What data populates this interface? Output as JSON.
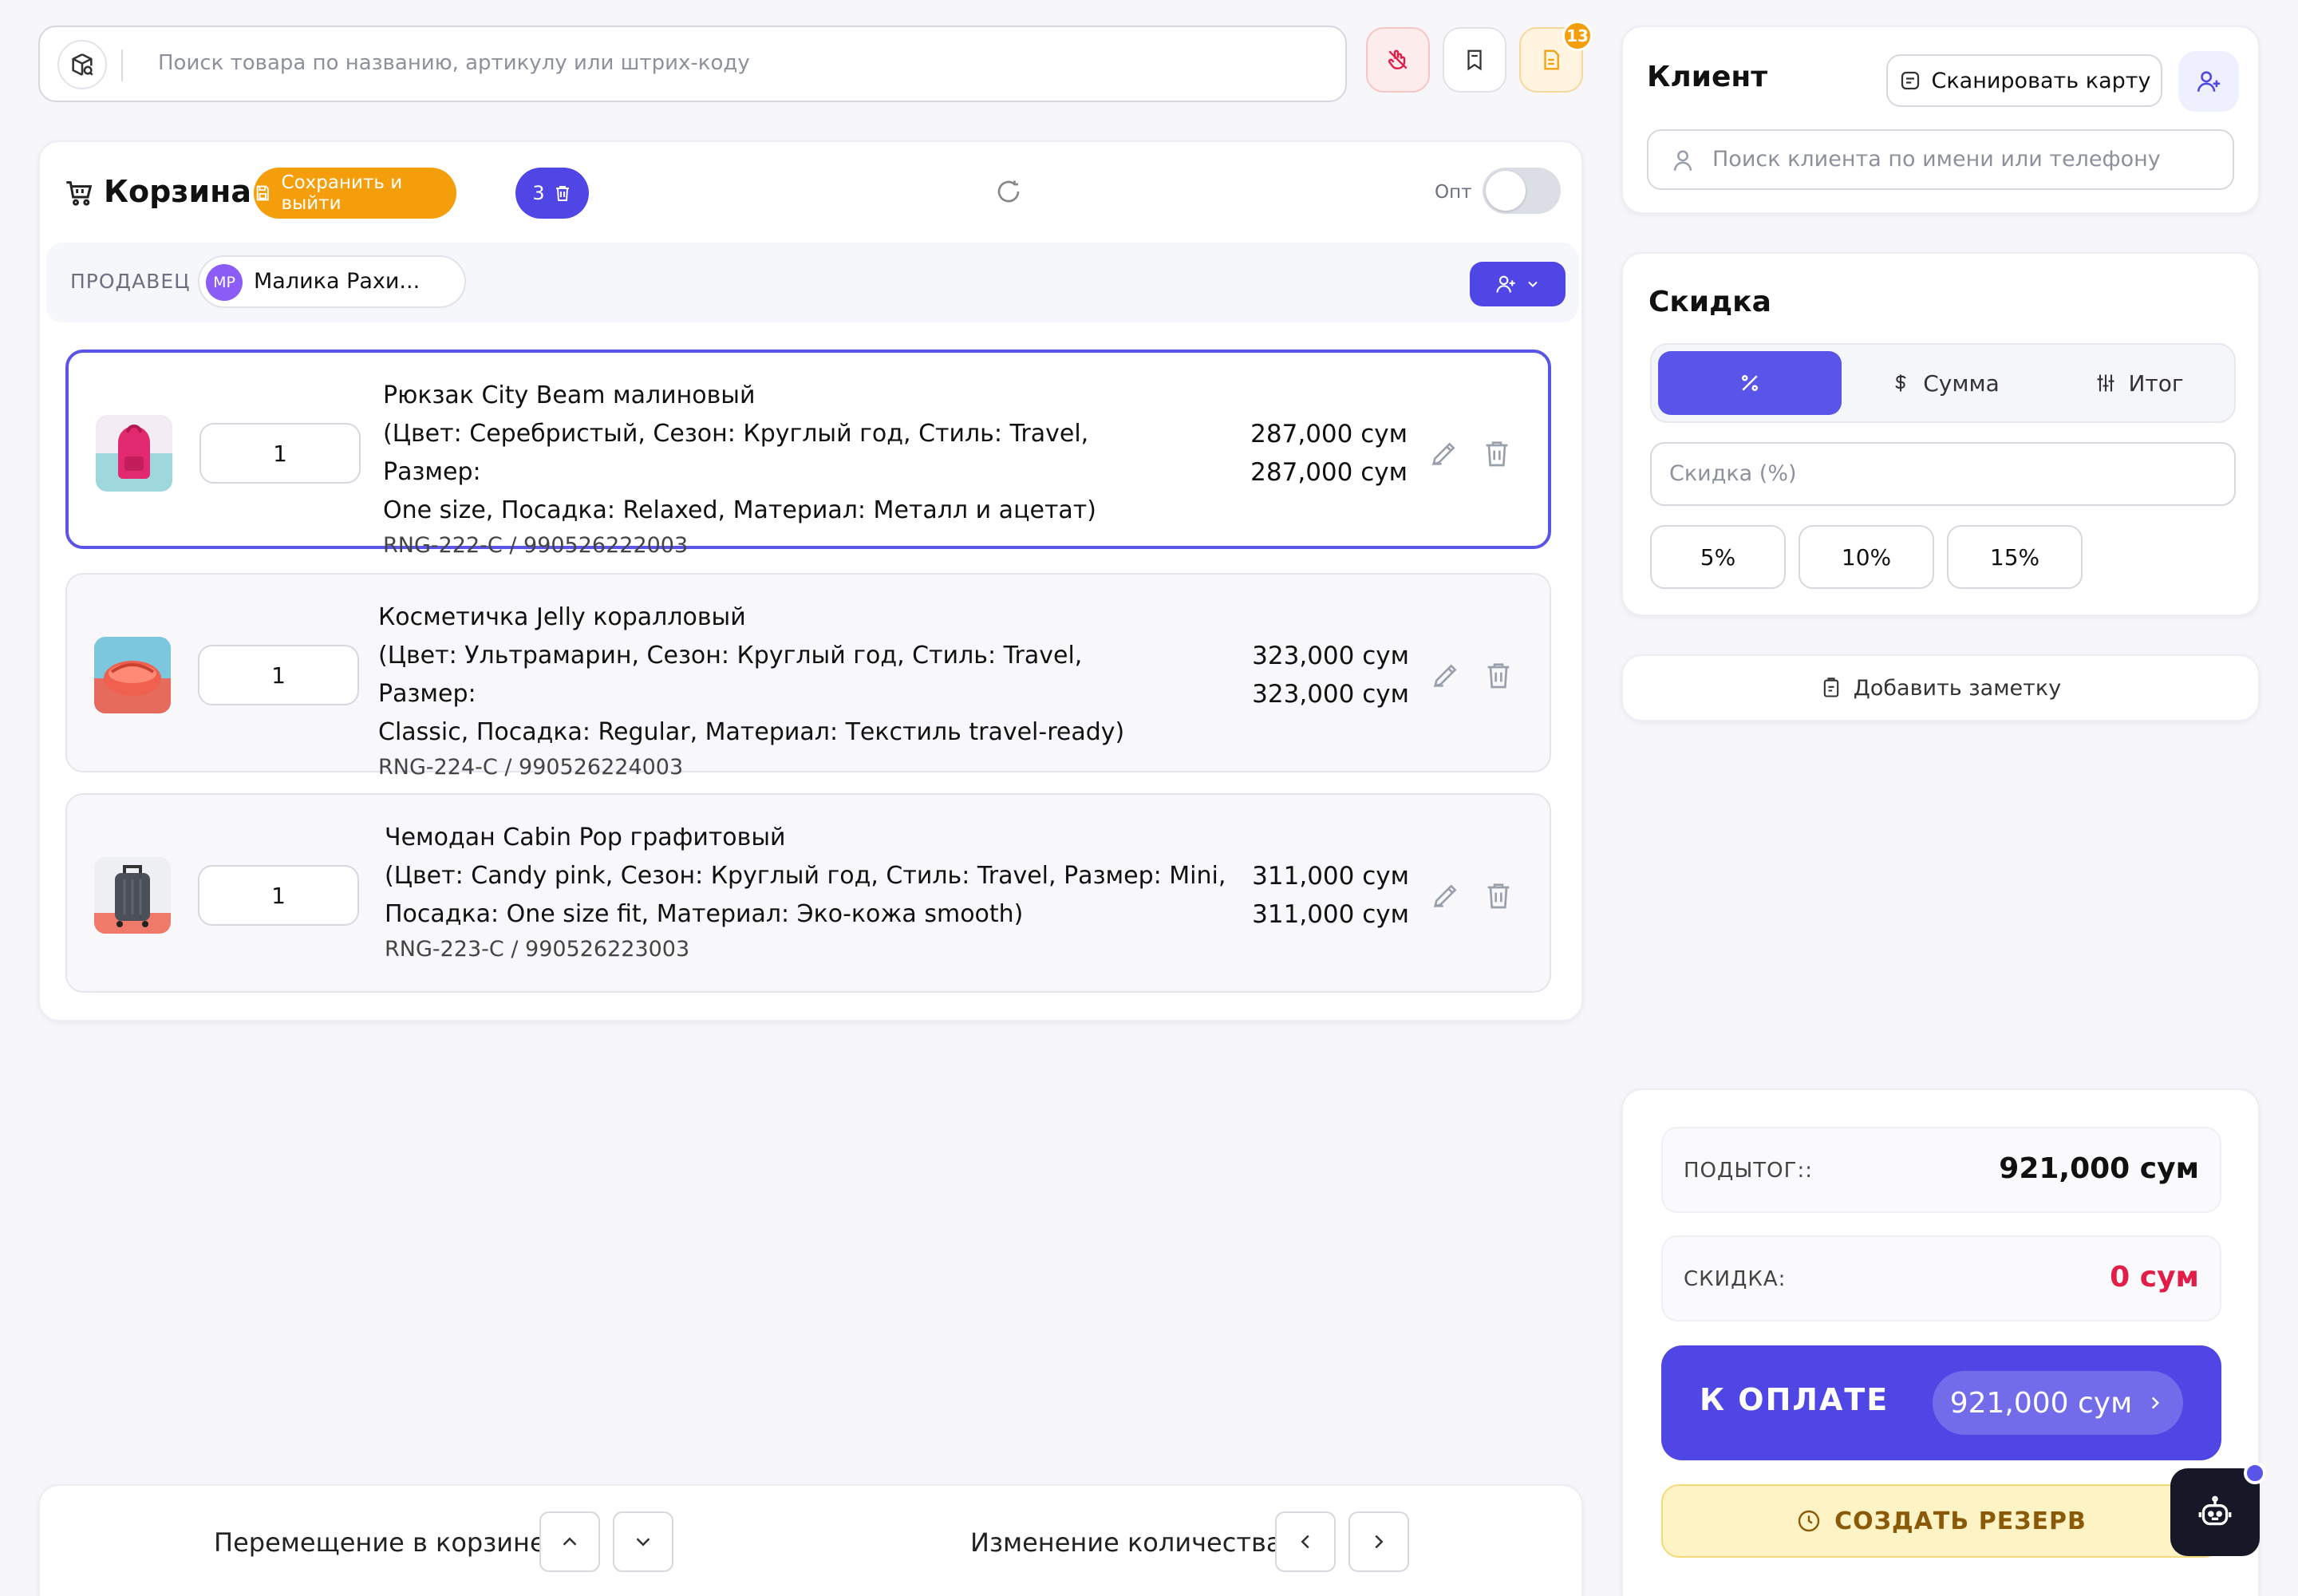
{
  "search": {
    "placeholder": "Поиск товара по названию, артикулу или штрих-коду"
  },
  "toolbar": {
    "notifications_count": "13"
  },
  "cart": {
    "title": "Корзина",
    "save_exit_label": "Сохранить и выйти",
    "item_count": "3",
    "wholesale_label": "Опт",
    "wholesale_enabled": false,
    "seller_label": "ПРОДАВЕЦ",
    "seller_initials": "МР",
    "seller_name": "Малика Рахи...",
    "items": [
      {
        "name": "Рюкзак City Beam малиновый",
        "attrs_line1": "(Цвет: Серебристый, Сезон: Круглый год, Стиль: Travel, Размер:",
        "attrs_line2": "One size, Посадка: Relaxed, Материал: Металл и ацетат)",
        "sku": "RNG-222-C / 990526222003",
        "qty": "1",
        "price": "287,000 сум",
        "total": "287,000 сум",
        "selected": true
      },
      {
        "name": "Косметичка Jelly коралловый",
        "attrs_line1": "(Цвет: Ультрамарин, Сезон: Круглый год, Стиль: Travel, Размер:",
        "attrs_line2": "Classic, Посадка: Regular, Материал: Текстиль travel-ready)",
        "sku": "RNG-224-C / 990526224003",
        "qty": "1",
        "price": "323,000 сум",
        "total": "323,000 сум",
        "selected": false
      },
      {
        "name": "Чемодан Cabin Pop графитовый",
        "attrs_line1": "(Цвет: Candy pink, Сезон: Круглый год, Стиль: Travel, Размер: Mini,",
        "attrs_line2": "Посадка: One size fit, Материал: Эко-кожа smooth)",
        "sku": "RNG-223-C / 990526223003",
        "qty": "1",
        "price": "311,000 сум",
        "total": "311,000 сум",
        "selected": false
      }
    ]
  },
  "bottom": {
    "move_label": "Перемещение в корзине",
    "qty_change_label": "Изменение количества"
  },
  "client": {
    "title": "Клиент",
    "scan_label": "Сканировать карту",
    "search_placeholder": "Поиск клиента по имени или телефону"
  },
  "discount": {
    "title": "Скидка",
    "mode_amount": "Сумма",
    "mode_total": "Итог",
    "input_placeholder": "Скидка (%)",
    "presets": [
      "5%",
      "10%",
      "15%"
    ]
  },
  "note": {
    "label": "Добавить заметку"
  },
  "totals": {
    "subtotal_label": "ПОДЫТОГ::",
    "subtotal_value": "921,000 сум",
    "discount_label": "СКИДКА:",
    "discount_value": "0 сум",
    "pay_label": "К ОПЛАТЕ",
    "pay_value": "921,000 сум",
    "reserve_label": "СОЗДАТЬ РЕЗЕРВ"
  },
  "colors": {
    "accent": "#4f46e5",
    "warning": "#f59e0b",
    "danger": "#e11d48"
  }
}
